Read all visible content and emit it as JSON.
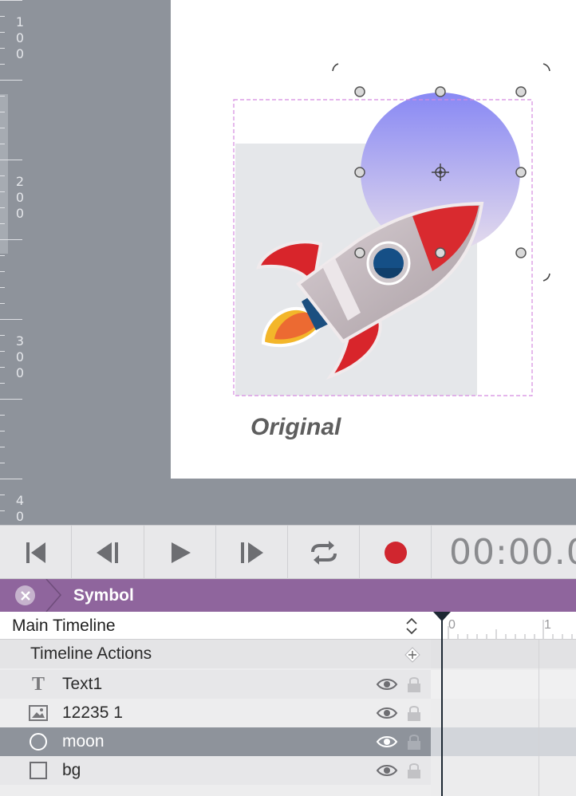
{
  "ruler": {
    "labels": [
      "100",
      "200",
      "300",
      "40"
    ]
  },
  "canvas": {
    "caption": "Original"
  },
  "transport": {
    "first_frame_icon": "skip-to-start-icon",
    "prev_frame_icon": "step-back-icon",
    "play_icon": "play-icon",
    "next_frame_icon": "step-forward-icon",
    "loop_icon": "loop-icon",
    "record_icon": "record-icon",
    "timecode": "00:00.0",
    "record_color": "#d0262f"
  },
  "symbol_bar": {
    "title": "Symbol",
    "color": "#8f659d"
  },
  "timeline": {
    "selector_label": "Main Timeline",
    "actions_label": "Timeline Actions",
    "ruler_labels": [
      "0",
      "1"
    ],
    "layers": [
      {
        "name": "Text1",
        "icon": "text-icon",
        "selected": false
      },
      {
        "name": "12235 1",
        "icon": "image-icon",
        "selected": false
      },
      {
        "name": "moon",
        "icon": "ellipse-icon",
        "selected": true
      },
      {
        "name": "bg",
        "icon": "rectangle-icon",
        "selected": false
      }
    ]
  }
}
